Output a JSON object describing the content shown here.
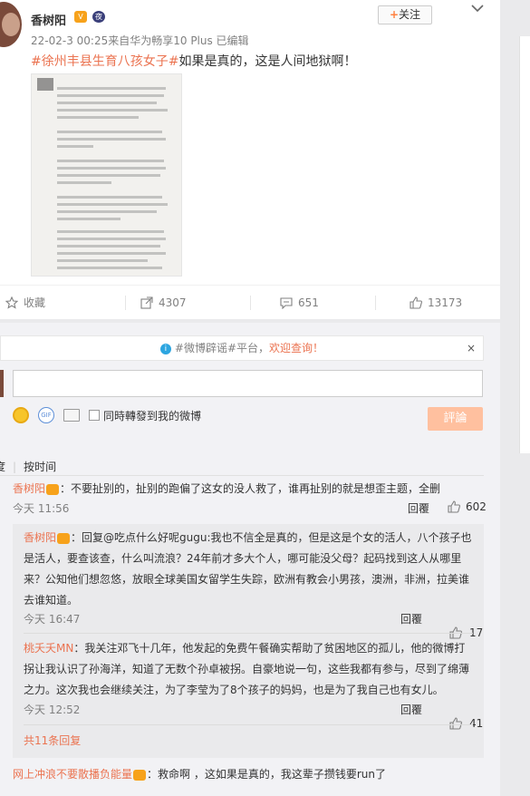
{
  "post": {
    "username": "香树阳",
    "vip_badge": "V",
    "level_badge": "夜",
    "meta": "22-02-3 00:25来自华为畅享10 Plus   已编辑",
    "follow_label": "关注",
    "follow_plus": "+",
    "hashtag": "#徐州丰县生育八孩女子#",
    "text": "如果是真的，这是人间地狱啊！"
  },
  "actions": {
    "favorite_label": "收藏",
    "repost_count": "4307",
    "comment_count": "651",
    "like_count": "13173"
  },
  "comment_panel": {
    "notice_prefix": "#微博辟谣#平台，",
    "notice_highlight": "欢迎查询！",
    "notice_close": "×",
    "input_value": "",
    "repost_checkbox_label": "同時轉發到我的微博",
    "submit_label": "評論",
    "sort_hot": "度",
    "sort_time": "按时间"
  },
  "comments": [
    {
      "author": "香树阳",
      "text": "：不要扯别的，扯别的跑偏了这女的没人救了，谁再扯别的就是想歪主题，全删",
      "time": "今天 11:56",
      "reply_label": "回覆",
      "likes": "602"
    }
  ],
  "replies": [
    {
      "author": "香树阳",
      "text": "：回复@吃点什么好呢gugu:我也不信全是真的，但是这是个女的活人，八个孩子也是活人，要查该查，什么叫流浪？24年前才多大个人，哪可能没父母？起码找到这人从哪里来？公知他们想忽悠，放眼全球美国女留学生失踪，欧洲有教会小男孩，澳洲，非洲，拉美谁去谁知道。",
      "time": "今天 16:47",
      "reply_label": "回覆",
      "likes": "17"
    },
    {
      "author": "桃夭夭MN",
      "text": "：我关注邓飞十几年，他发起的免费午餐确实帮助了贫困地区的孤儿，他的微博打拐让我认识了孙海洋，知道了无数个孙卓被拐。自豪地说一句，这些我都有参与，尽到了绵薄之力。这次我也会继续关注，为了李莹为了8个孩子的妈妈，也是为了我自己也有女儿。",
      "time": "今天 12:52",
      "reply_label": "回覆",
      "likes": "41"
    }
  ],
  "all_replies_label": "共11条回复",
  "comment2": {
    "author": "网上冲浪不要散播负能量",
    "text": "：救命啊 ，这如果是真的，我这辈子攒钱要run了"
  },
  "colors": {
    "accent": "#eb7350",
    "submit_disabled": "#ffc09f",
    "panel_bg": "#f2f2f5"
  }
}
